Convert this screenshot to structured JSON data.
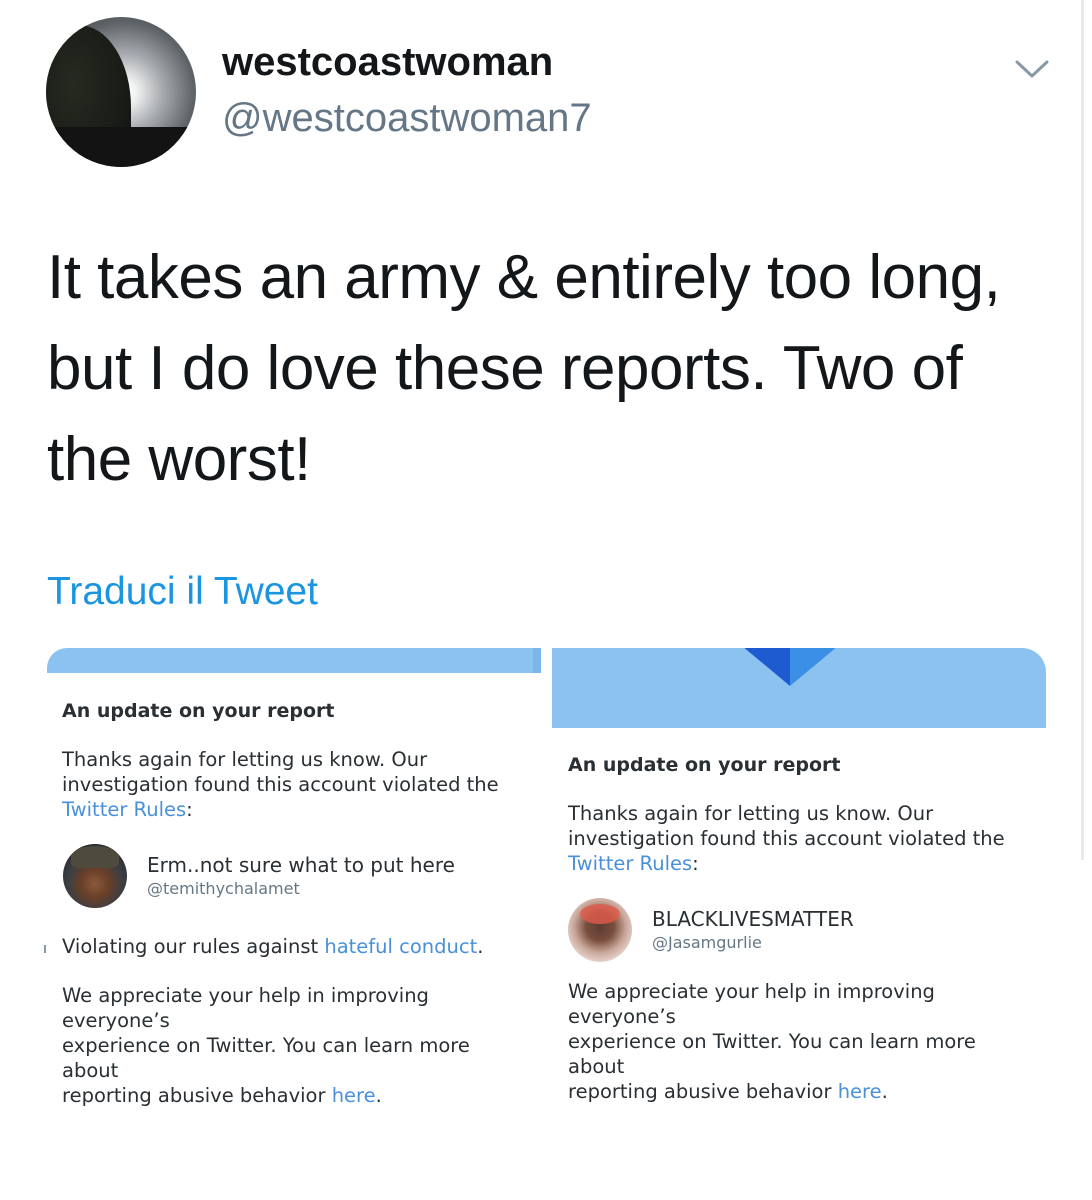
{
  "tweet": {
    "display_name": "westcoastwoman",
    "handle": "@westcoastwoman7",
    "text_line1": "It takes an army & entirely too long,",
    "text_line2": "but I do love these reports. Two of",
    "text_line3": "the worst!",
    "translate_label": "Traduci il Tweet",
    "menu_icon": "chevron-down-icon"
  },
  "report_left": {
    "title": "An update on your report",
    "body_line1": "Thanks again for letting us know. Our",
    "body_line2": "investigation found this account violated the",
    "rules_link": "Twitter Rules",
    "rules_suffix": ":",
    "reported_name": "Erm..not sure what to put here",
    "reported_handle": "@temithychalamet",
    "violation_prefix": "Violating our rules against ",
    "violation_link": "hateful conduct",
    "violation_suffix": ".",
    "appreciate_line1": "We appreciate your help in improving everyone’s",
    "appreciate_line2": "experience on Twitter. You can learn more about",
    "appreciate_line3_prefix": "reporting abusive behavior ",
    "here_link": "here",
    "here_suffix": "."
  },
  "report_right": {
    "title": "An update on your report",
    "body_line1": "Thanks again for letting us know. Our",
    "body_line2": "investigation found this account violated the",
    "rules_link": "Twitter Rules",
    "rules_suffix": ":",
    "reported_name": "BLACKLIVESMATTER",
    "reported_handle": "@Jasamgurlie",
    "appreciate_line1": "We appreciate your help in improving everyone’s",
    "appreciate_line2": "experience on Twitter. You can learn more about",
    "appreciate_line3_prefix": "reporting abusive behavior ",
    "here_link": "here",
    "here_suffix": "."
  },
  "colors": {
    "link": "#1b95e0",
    "banner": "#8cc2f0",
    "text": "#14171a",
    "muted": "#657786"
  }
}
